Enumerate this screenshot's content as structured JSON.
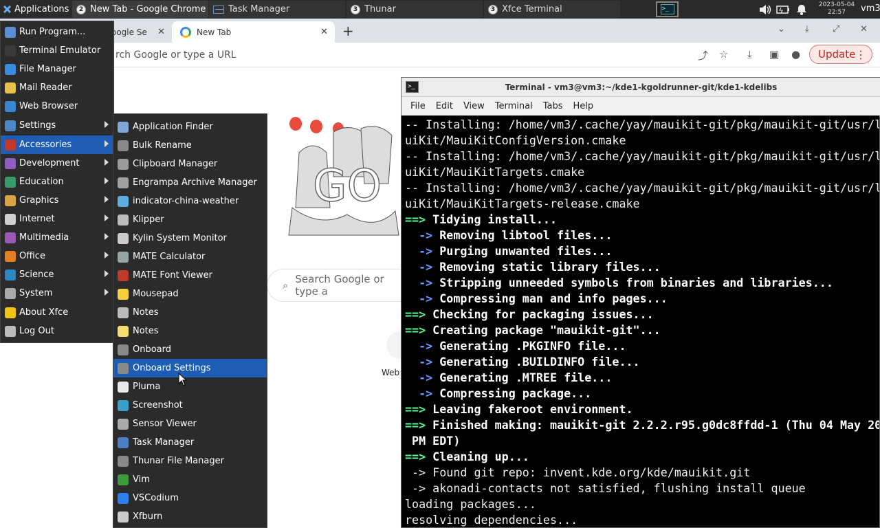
{
  "panel": {
    "applications_label": "Applications",
    "tasks": [
      {
        "badge": "2",
        "label": "New Tab - Google Chrome"
      },
      {
        "badge": "",
        "label": "Task Manager"
      },
      {
        "badge": "3",
        "label": "Thunar"
      },
      {
        "badge": "3",
        "label": "Xfce Terminal"
      }
    ],
    "clock_date": "2023-05-04",
    "clock_time": "22:57",
    "user": "vm3",
    "tray_icons": [
      "volume-icon",
      "battery-icon",
      "notification-bell-icon"
    ]
  },
  "chrome": {
    "tabs": [
      {
        "label": "oogle Se"
      },
      {
        "label": "New Tab"
      }
    ],
    "omnibox_placeholder": "rch Google or type a URL",
    "update_label": "Update",
    "search_placeholder": "Search Google or type a",
    "shortcut_label": "Web",
    "doodle_text": "GO"
  },
  "terminal": {
    "title": "Terminal - vm3@vm3:~/kde1-kgoldrunner-git/kde1-kdelibs",
    "menu": [
      "File",
      "Edit",
      "View",
      "Terminal",
      "Tabs",
      "Help"
    ],
    "lines": [
      {
        "prefix": "",
        "text": "-- Installing: /home/vm3/.cache/yay/mauikit-git/pkg/mauikit-git/usr/l",
        "style": "n"
      },
      {
        "prefix": "",
        "text": "uiKit/MauiKitConfigVersion.cmake",
        "style": "n"
      },
      {
        "prefix": "",
        "text": "-- Installing: /home/vm3/.cache/yay/mauikit-git/pkg/mauikit-git/usr/l",
        "style": "n"
      },
      {
        "prefix": "",
        "text": "uiKit/MauiKitTargets.cmake",
        "style": "n"
      },
      {
        "prefix": "",
        "text": "-- Installing: /home/vm3/.cache/yay/mauikit-git/pkg/mauikit-git/usr/l",
        "style": "n"
      },
      {
        "prefix": "",
        "text": "uiKit/MauiKitTargets-release.cmake",
        "style": "n"
      },
      {
        "prefix": "==>",
        "text": " Tidying install...",
        "style": "w"
      },
      {
        "prefix": "  ->",
        "text": " Removing libtool files...",
        "style": "w"
      },
      {
        "prefix": "  ->",
        "text": " Purging unwanted files...",
        "style": "w"
      },
      {
        "prefix": "  ->",
        "text": " Removing static library files...",
        "style": "w"
      },
      {
        "prefix": "  ->",
        "text": " Stripping unneeded symbols from binaries and libraries...",
        "style": "w"
      },
      {
        "prefix": "  ->",
        "text": " Compressing man and info pages...",
        "style": "w"
      },
      {
        "prefix": "==>",
        "text": " Checking for packaging issues...",
        "style": "w"
      },
      {
        "prefix": "==>",
        "text": " Creating package \"mauikit-git\"...",
        "style": "w"
      },
      {
        "prefix": "  ->",
        "text": " Generating .PKGINFO file...",
        "style": "w"
      },
      {
        "prefix": "  ->",
        "text": " Generating .BUILDINFO file...",
        "style": "w"
      },
      {
        "prefix": "  ->",
        "text": " Generating .MTREE file...",
        "style": "w"
      },
      {
        "prefix": "  ->",
        "text": " Compressing package...",
        "style": "w"
      },
      {
        "prefix": "==>",
        "text": " Leaving fakeroot environment.",
        "style": "w"
      },
      {
        "prefix": "==>",
        "text": " Finished making: mauikit-git 2.2.2.r95.g0dc8ffdd-1 (Thu 04 May 20",
        "style": "w"
      },
      {
        "prefix": "",
        "text": " PM EDT)",
        "style": "w"
      },
      {
        "prefix": "==>",
        "text": " Cleaning up...",
        "style": "w"
      },
      {
        "prefix": "",
        "text": " -> Found git repo: invent.kde.org/kde/mauikit.git",
        "style": "n"
      },
      {
        "prefix": "",
        "text": " -> akonadi-contacts not satisfied, flushing install queue",
        "style": "n"
      },
      {
        "prefix": "",
        "text": "loading packages...",
        "style": "n"
      },
      {
        "prefix": "",
        "text": "resolving dependencies...",
        "style": "n"
      }
    ]
  },
  "menu": {
    "items": [
      {
        "label": "Run Program...",
        "icon": "run-program-icon",
        "color": "#5a8fd8",
        "submenu": false
      },
      {
        "label": "Terminal Emulator",
        "icon": "terminal-icon",
        "color": "#3a3a3a",
        "submenu": false
      },
      {
        "label": "File Manager",
        "icon": "file-manager-icon",
        "color": "#3b8be0",
        "submenu": false
      },
      {
        "label": "Mail Reader",
        "icon": "mail-icon",
        "color": "#e8c14a",
        "submenu": false
      },
      {
        "label": "Web Browser",
        "icon": "web-browser-icon",
        "color": "#3a86d4",
        "submenu": false
      },
      {
        "label": "Settings",
        "icon": "settings-icon",
        "color": "#4a86c8",
        "submenu": true
      },
      {
        "label": "Accessories",
        "icon": "accessories-icon",
        "color": "#c0392b",
        "submenu": true
      },
      {
        "label": "Development",
        "icon": "development-icon",
        "color": "#8e5fbf",
        "submenu": true
      },
      {
        "label": "Education",
        "icon": "education-icon",
        "color": "#3a9a6a",
        "submenu": true
      },
      {
        "label": "Graphics",
        "icon": "graphics-icon",
        "color": "#d9a441",
        "submenu": true
      },
      {
        "label": "Internet",
        "icon": "internet-icon",
        "color": "#d0d0d0",
        "submenu": true
      },
      {
        "label": "Multimedia",
        "icon": "multimedia-icon",
        "color": "#9b59b6",
        "submenu": true
      },
      {
        "label": "Office",
        "icon": "office-icon",
        "color": "#e67e22",
        "submenu": true
      },
      {
        "label": "Science",
        "icon": "science-icon",
        "color": "#2e86c1",
        "submenu": true
      },
      {
        "label": "System",
        "icon": "system-icon",
        "color": "#aaaaaa",
        "submenu": true
      },
      {
        "label": "About Xfce",
        "icon": "star-icon",
        "color": "#f1c40f",
        "submenu": false
      },
      {
        "label": "Log Out",
        "icon": "log-out-icon",
        "color": "#bbbbbb",
        "submenu": false
      }
    ],
    "selected_index": 6
  },
  "submenu": {
    "items": [
      {
        "label": "Application Finder",
        "icon": "app-finder-icon",
        "color": "#7fa8d8"
      },
      {
        "label": "Bulk Rename",
        "icon": "bulk-rename-icon",
        "color": "#888888"
      },
      {
        "label": "Clipboard Manager",
        "icon": "clipboard-icon",
        "color": "#9a9a9a"
      },
      {
        "label": "Engrampa Archive Manager",
        "icon": "archive-icon",
        "color": "#a0a0a0"
      },
      {
        "label": "indicator-china-weather",
        "icon": "weather-icon",
        "color": "#5dade2"
      },
      {
        "label": "Klipper",
        "icon": "klipper-icon",
        "color": "#bbbbbb"
      },
      {
        "label": "Kylin System Monitor",
        "icon": "system-monitor-icon",
        "color": "#cccccc"
      },
      {
        "label": "MATE Calculator",
        "icon": "calculator-icon",
        "color": "#95a5a6"
      },
      {
        "label": "MATE Font Viewer",
        "icon": "font-viewer-icon",
        "color": "#c0392b"
      },
      {
        "label": "Mousepad",
        "icon": "mousepad-icon",
        "color": "#f4d03f"
      },
      {
        "label": "Notes",
        "icon": "notes-icon",
        "color": "#bbbbbb"
      },
      {
        "label": "Notes",
        "icon": "sticky-notes-icon",
        "color": "#f7dc6f"
      },
      {
        "label": "Onboard",
        "icon": "keyboard-icon",
        "color": "#888888"
      },
      {
        "label": "Onboard Settings",
        "icon": "keyboard-settings-icon",
        "color": "#888888"
      },
      {
        "label": "Pluma",
        "icon": "pluma-icon",
        "color": "#e8e8e8"
      },
      {
        "label": "Screenshot",
        "icon": "screenshot-icon",
        "color": "#3aa0c8"
      },
      {
        "label": "Sensor Viewer",
        "icon": "sensor-icon",
        "color": "#aaaaaa"
      },
      {
        "label": "Task Manager",
        "icon": "task-manager-icon",
        "color": "#4a7fc1"
      },
      {
        "label": "Thunar File Manager",
        "icon": "thunar-icon",
        "color": "#888888"
      },
      {
        "label": "Vim",
        "icon": "vim-icon",
        "color": "#3c9a3c"
      },
      {
        "label": "VSCodium",
        "icon": "vscodium-icon",
        "color": "#2f80ed"
      },
      {
        "label": "Xfburn",
        "icon": "xfburn-icon",
        "color": "#cccccc"
      }
    ],
    "selected_index": 13
  }
}
